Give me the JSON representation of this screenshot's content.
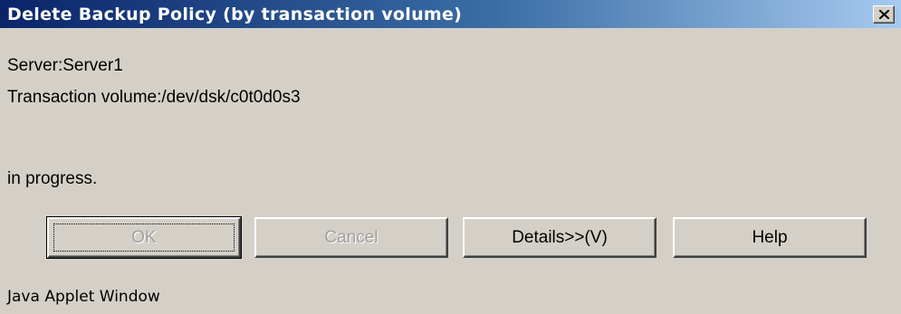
{
  "window": {
    "title": "Delete Backup Policy (by transaction volume)"
  },
  "info": {
    "server": "Server:Server1",
    "transaction_volume": "Transaction volume:/dev/dsk/c0t0d0s3",
    "status": "in progress."
  },
  "buttons": {
    "ok": "OK",
    "cancel": "Cancel",
    "details": "Details>>(V)",
    "help": "Help"
  },
  "footer": {
    "text": "Java Applet Window"
  }
}
